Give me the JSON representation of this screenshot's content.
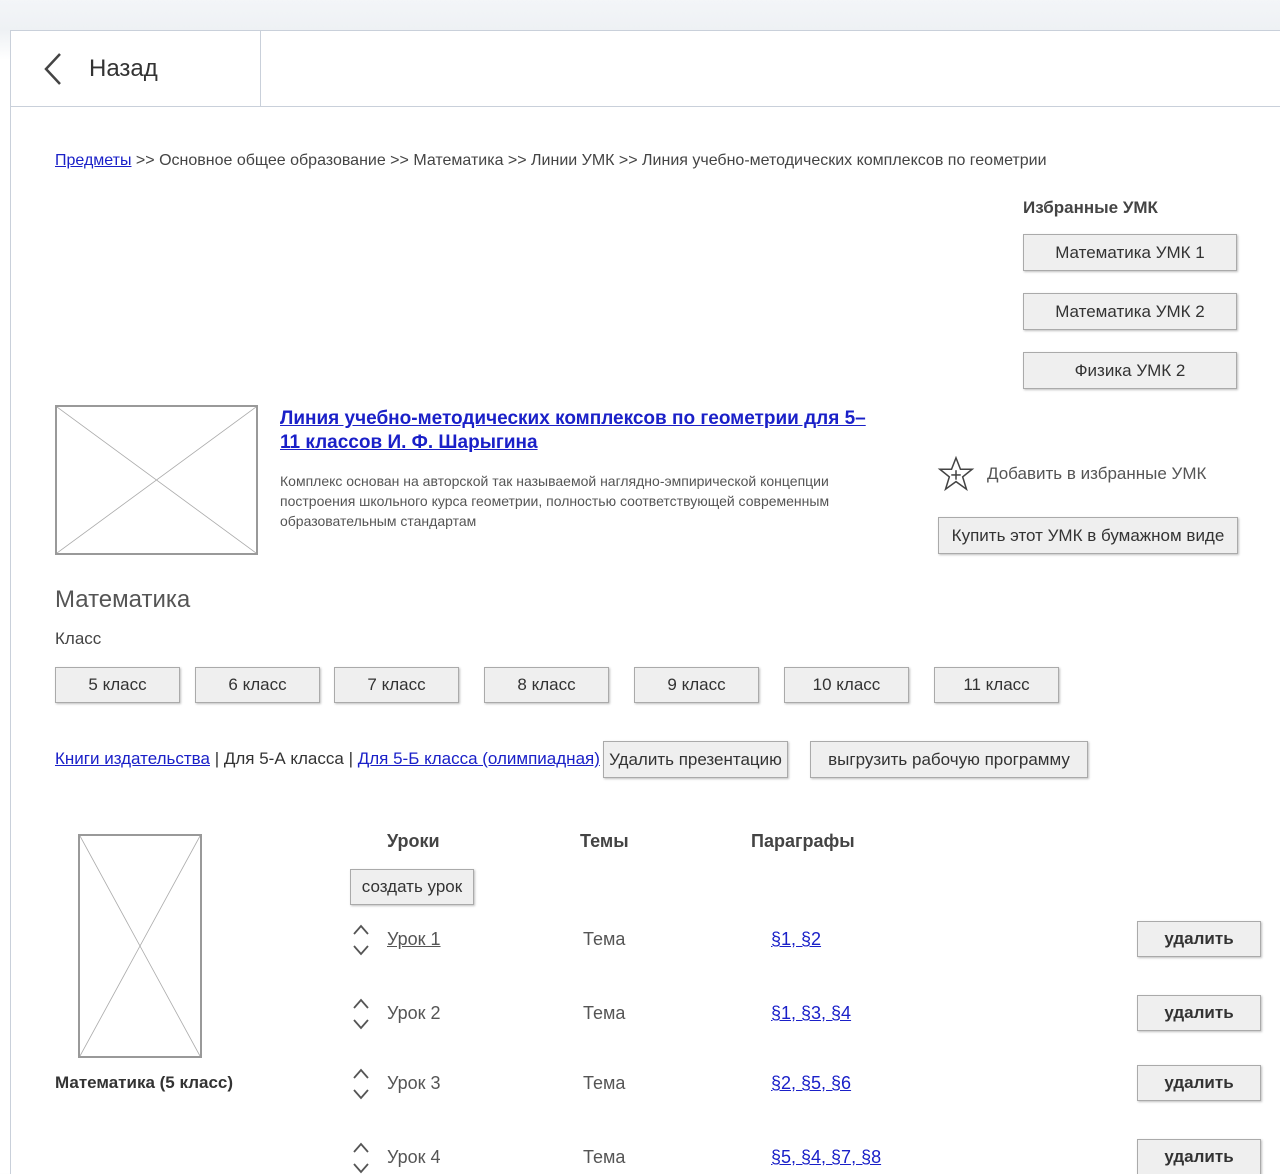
{
  "back": {
    "label": "Назад"
  },
  "breadcrumb": {
    "link": "Предметы",
    "rest": " >> Основное общее образование >> Математика >> Линии УМК >> Линия учебно-методических комплексов по геометрии"
  },
  "favorites": {
    "title": "Избранные УМК",
    "items": [
      "Математика УМК 1",
      "Математика УМК 2",
      "Физика УМК 2"
    ]
  },
  "course": {
    "title": "Линия учебно-методических комплексов по геометрии для 5–11 классов И. Ф. Шарыгина",
    "description": "Комплекс основан на авторской так называемой наглядно-эмпирической концепции построения школьного курса геометрии, полностью соответствующей современным образовательным стандартам",
    "add_favorite": "Добавить в избранные УМК",
    "buy_button": "Купить этот УМК в бумажном виде"
  },
  "subject": {
    "title": "Математика",
    "class_label": "Класс"
  },
  "classes": [
    "5 класс",
    "6 класс",
    "7 класс",
    "8 класс",
    "9 класс",
    "10 класс",
    "11 класс"
  ],
  "tabs": {
    "publisher_books": "Книги издательства",
    "sep1": " | ",
    "class_5a": "Для 5-А класса",
    "sep2": " | ",
    "class_5b": "Для 5-Б класса (олимпиадная)",
    "delete_presentation": "Удалить презентацию",
    "export_program": "выгрузить рабочую программу"
  },
  "lessons_table": {
    "headers": {
      "lessons": "Уроки",
      "themes": "Темы",
      "paragraphs": "Параграфы"
    },
    "create_button": "создать урок",
    "book_caption": "Математика (5 класс)",
    "delete_label": "удалить",
    "rows": [
      {
        "name": "Урок 1",
        "theme": "Тема",
        "paragraphs": "§1, §2",
        "linked": true
      },
      {
        "name": "Урок 2",
        "theme": "Тема",
        "paragraphs": "§1, §3, §4",
        "linked": false
      },
      {
        "name": "Урок 3",
        "theme": "Тема",
        "paragraphs": "§2, §5, §6",
        "linked": false
      },
      {
        "name": "Урок 4",
        "theme": "Тема",
        "paragraphs": "§5, §4, §7, §8",
        "linked": false
      }
    ]
  },
  "colors": {
    "link": "#1a20c8",
    "border": "#c9d0da",
    "button_bg": "#efefef"
  }
}
